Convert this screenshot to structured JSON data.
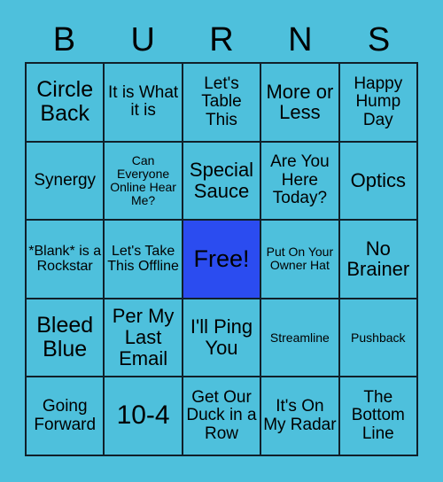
{
  "header": {
    "letters": [
      "B",
      "U",
      "R",
      "N",
      "S"
    ]
  },
  "grid": {
    "rows": [
      [
        {
          "text": "Circle Back",
          "size": "fs-xl",
          "free": false
        },
        {
          "text": "It is What it is",
          "size": "fs-md",
          "free": false
        },
        {
          "text": "Let's Table This",
          "size": "fs-md",
          "free": false
        },
        {
          "text": "More or Less",
          "size": "fs-lg",
          "free": false
        },
        {
          "text": "Happy Hump Day",
          "size": "fs-md",
          "free": false
        }
      ],
      [
        {
          "text": "Synergy",
          "size": "fs-md",
          "free": false
        },
        {
          "text": "Can Everyone Online Hear Me?",
          "size": "fs-xs",
          "free": false
        },
        {
          "text": "Special Sauce",
          "size": "fs-lg",
          "free": false
        },
        {
          "text": "Are You Here Today?",
          "size": "fs-md",
          "free": false
        },
        {
          "text": "Optics",
          "size": "fs-lg",
          "free": false
        }
      ],
      [
        {
          "text": "*Blank* is a Rockstar",
          "size": "fs-sm",
          "free": false
        },
        {
          "text": "Let's Take This Offline",
          "size": "fs-sm",
          "free": false
        },
        {
          "text": "Free!",
          "size": "fs-free",
          "free": true
        },
        {
          "text": "Put On Your Owner Hat",
          "size": "fs-xs",
          "free": false
        },
        {
          "text": "No Brainer",
          "size": "fs-lg",
          "free": false
        }
      ],
      [
        {
          "text": "Bleed Blue",
          "size": "fs-xl",
          "free": false
        },
        {
          "text": "Per My Last Email",
          "size": "fs-lg",
          "free": false
        },
        {
          "text": "I'll Ping You",
          "size": "fs-lg",
          "free": false
        },
        {
          "text": "Streamline",
          "size": "fs-xs",
          "free": false
        },
        {
          "text": "Pushback",
          "size": "fs-xs",
          "free": false
        }
      ],
      [
        {
          "text": "Going Forward",
          "size": "fs-md",
          "free": false
        },
        {
          "text": "10-4",
          "size": "fs-num",
          "free": false
        },
        {
          "text": "Get Our Duck in a Row",
          "size": "fs-md",
          "free": false
        },
        {
          "text": "It's On My Radar",
          "size": "fs-md",
          "free": false
        },
        {
          "text": "The Bottom Line",
          "size": "fs-md",
          "free": false
        }
      ]
    ]
  },
  "colors": {
    "background": "#4ec0dc",
    "cell_background": "#4ec0dc",
    "free_square": "#2b4cf0",
    "border": "#10202a",
    "text": "#000000"
  }
}
